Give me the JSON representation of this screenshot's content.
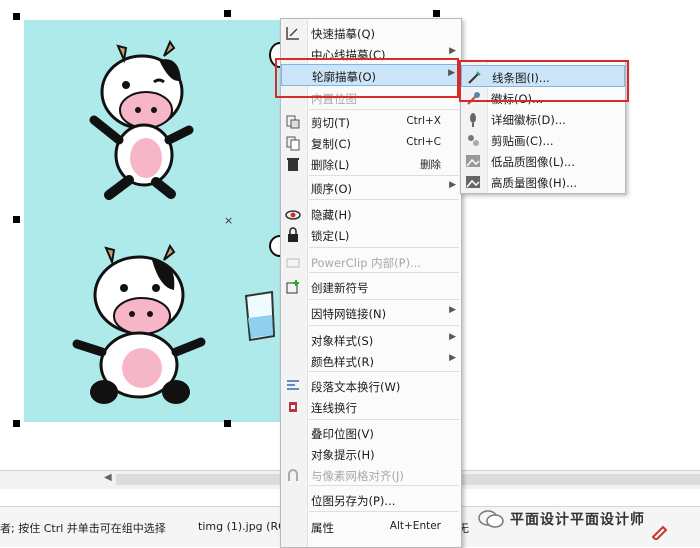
{
  "main_menu": [
    {
      "label": "快速描摹(Q)",
      "arrow": false,
      "disabled": false,
      "shortcut": "",
      "icon": "quick-trace-icon"
    },
    {
      "label": "中心线描摹(C)",
      "arrow": true,
      "disabled": false,
      "shortcut": "",
      "icon": ""
    },
    {
      "label": "轮廓描摹(O)",
      "arrow": true,
      "disabled": false,
      "shortcut": "",
      "icon": "",
      "selected": true
    },
    {
      "label": "内置位图",
      "arrow": false,
      "disabled": true,
      "shortcut": "",
      "icon": ""
    },
    {
      "label": "剪切(T)",
      "arrow": false,
      "disabled": false,
      "shortcut": "Ctrl+X",
      "icon": "cut-icon"
    },
    {
      "label": "复制(C)",
      "arrow": false,
      "disabled": false,
      "shortcut": "Ctrl+C",
      "icon": "copy-icon"
    },
    {
      "label": "删除(L)",
      "arrow": false,
      "disabled": false,
      "shortcut": "删除",
      "icon": "trash-icon"
    },
    {
      "label": "顺序(O)",
      "arrow": true,
      "disabled": false,
      "shortcut": "",
      "icon": ""
    },
    {
      "label": "隐藏(H)",
      "arrow": false,
      "disabled": false,
      "shortcut": "",
      "icon": "hide-icon"
    },
    {
      "label": "锁定(L)",
      "arrow": false,
      "disabled": false,
      "shortcut": "",
      "icon": "lock-icon"
    },
    {
      "label": "PowerClip 内部(P)...",
      "arrow": false,
      "disabled": true,
      "shortcut": "",
      "icon": "powerclip-icon"
    },
    {
      "label": "创建新符号",
      "arrow": false,
      "disabled": false,
      "shortcut": "",
      "icon": "new-symbol-icon"
    },
    {
      "label": "因特网链接(N)",
      "arrow": true,
      "disabled": false,
      "shortcut": "",
      "icon": ""
    },
    {
      "label": "对象样式(S)",
      "arrow": true,
      "disabled": false,
      "shortcut": "",
      "icon": ""
    },
    {
      "label": "颜色样式(R)",
      "arrow": true,
      "disabled": false,
      "shortcut": "",
      "icon": ""
    },
    {
      "label": "段落文本换行(W)",
      "arrow": false,
      "disabled": false,
      "shortcut": "",
      "icon": "wrap-text-icon"
    },
    {
      "label": "连线换行",
      "arrow": false,
      "disabled": false,
      "shortcut": "",
      "icon": "connector-wrap-icon"
    },
    {
      "label": "叠印位图(V)",
      "arrow": false,
      "disabled": false,
      "shortcut": "",
      "icon": ""
    },
    {
      "label": "对象提示(H)",
      "arrow": false,
      "disabled": false,
      "shortcut": "",
      "icon": ""
    },
    {
      "label": "与像素网格对齐(J)",
      "arrow": false,
      "disabled": true,
      "shortcut": "",
      "icon": "magnet-icon"
    },
    {
      "label": "位图另存为(P)...",
      "arrow": false,
      "disabled": false,
      "shortcut": "",
      "icon": ""
    },
    {
      "label": "属性",
      "arrow": false,
      "disabled": false,
      "shortcut": "Alt+Enter",
      "icon": ""
    }
  ],
  "sub_menu": [
    {
      "label": "线条图(I)...",
      "icon": "line-art-icon",
      "selected": true
    },
    {
      "label": "徽标(O)...",
      "icon": "logo-icon"
    },
    {
      "label": "详细徽标(D)...",
      "icon": "detailed-logo-icon"
    },
    {
      "label": "剪贴画(C)...",
      "icon": "clipart-icon"
    },
    {
      "label": "低品质图像(L)...",
      "icon": "low-quality-image-icon"
    },
    {
      "label": "高质量图像(H)...",
      "icon": "high-quality-image-icon"
    }
  ],
  "status": {
    "hint": "者; 按住 Ctrl 并单击可在组中选择",
    "file": "timg (1).jpg (RGB)",
    "extra": "无"
  },
  "watermark": "平面设计平面设计师",
  "colors": {
    "canvas_bg": "#aeeaea",
    "highlight": "#cce4f7",
    "red_box": "#d62b2b"
  }
}
